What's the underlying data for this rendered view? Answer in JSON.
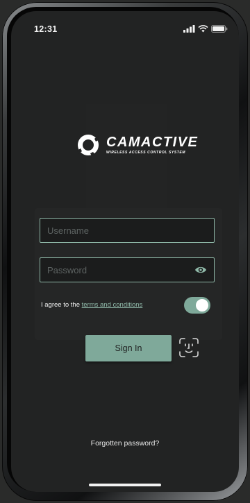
{
  "status_bar": {
    "time": "12:31",
    "icons": [
      "cellular-signal-icon",
      "wifi-icon",
      "battery-icon"
    ]
  },
  "brand": {
    "name": "CAMACTIVE",
    "tagline": "WIRELESS ACCESS CONTROL SYSTEM",
    "logo_icon": "camactive-ring-icon"
  },
  "form": {
    "username": {
      "placeholder": "Username",
      "value": ""
    },
    "password": {
      "placeholder": "Password",
      "value": "",
      "toggle_icon": "eye-icon"
    },
    "agree": {
      "prefix": "I agree to the ",
      "link_text": "terms and conditions",
      "toggle_on": true
    },
    "sign_in_label": "Sign In",
    "biometric_icon": "face-id-icon"
  },
  "forgot_password_label": "Forgotten password?",
  "colors": {
    "accent": "#7fa99a",
    "field_border": "#8fb8a8",
    "background": "#222323"
  }
}
